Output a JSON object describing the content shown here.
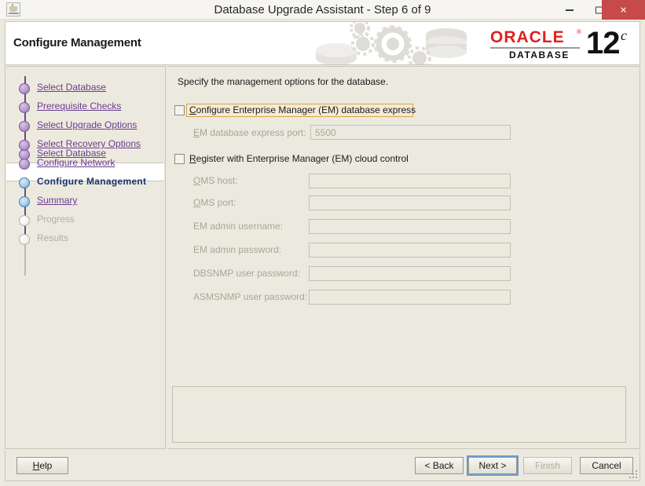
{
  "window": {
    "title": "Database Upgrade Assistant - Step 6 of 9",
    "app_icon": "java-coffee-cup-icon",
    "controls": {
      "minimize": "minimize-icon",
      "maximize": "maximize-icon",
      "close": "×"
    }
  },
  "header": {
    "page_title": "Configure Management",
    "logo": {
      "brand": "ORACLE",
      "trademark": "®",
      "product": "DATABASE",
      "version_number": "12",
      "version_suffix": "c"
    },
    "artwork": "gears-and-database-cylinders-watermark"
  },
  "sidebar": {
    "steps": [
      {
        "label": "Select Database",
        "state": "done"
      },
      {
        "label": "Prerequisite Checks",
        "state": "done"
      },
      {
        "label": "Select Upgrade Options",
        "state": "done"
      },
      {
        "label": "Select Recovery Options",
        "state": "done"
      },
      {
        "label": "Configure Network",
        "state": "done"
      },
      {
        "label": "Configure Management",
        "state": "current"
      },
      {
        "label": "Summary",
        "state": "link"
      },
      {
        "label": "Progress",
        "state": "todo"
      },
      {
        "label": "Results",
        "state": "todo"
      }
    ]
  },
  "content": {
    "instruction": "Specify the management options for the database.",
    "checkboxes": [
      {
        "id": "configure-em-express",
        "label_before": "C",
        "label_mnemonic": "",
        "label": "Configure Enterprise Manager (EM) database express",
        "checked": false,
        "focused": true
      },
      {
        "id": "register-em-cloud-control",
        "label": "Register with Enterprise Manager (EM) cloud control",
        "checked": false,
        "focused": false
      }
    ],
    "fields": [
      {
        "id": "em-express-port",
        "label": "EM database express port:",
        "value": "5500",
        "enabled": false
      },
      {
        "id": "oms-host",
        "label": "OMS host:",
        "value": "",
        "enabled": false
      },
      {
        "id": "oms-port",
        "label": "OMS port:",
        "value": "",
        "enabled": false
      },
      {
        "id": "em-admin-username",
        "label": "EM admin username:",
        "value": "",
        "enabled": false
      },
      {
        "id": "em-admin-password",
        "label": "EM admin password:",
        "value": "",
        "enabled": false
      },
      {
        "id": "dbsnmp-user-password",
        "label": "DBSNMP user password:",
        "value": "",
        "enabled": false
      },
      {
        "id": "asmsnmp-user-password",
        "label": "ASMSNMP user password:",
        "value": "",
        "enabled": false
      }
    ],
    "message_panel": ""
  },
  "buttons": {
    "help": {
      "label": "Help",
      "enabled": true,
      "focused": false
    },
    "back": {
      "label": "< Back",
      "enabled": true,
      "focused": false
    },
    "next": {
      "label": "Next >",
      "enabled": true,
      "focused": true
    },
    "finish": {
      "label": "Finish",
      "enabled": false,
      "focused": false
    },
    "cancel": {
      "label": "Cancel",
      "enabled": true,
      "focused": false
    }
  },
  "colors": {
    "window_background": "#eceadf",
    "titlebar": "#f6f5f2",
    "close_button": "#c64a4a",
    "oracle_red": "#e02020",
    "link_purple": "#6b3a8f",
    "current_step": "#17366b",
    "disabled_text": "#a9a598",
    "focus_blue": "#6b9bd2",
    "focus_amber": "#d8a24a"
  }
}
